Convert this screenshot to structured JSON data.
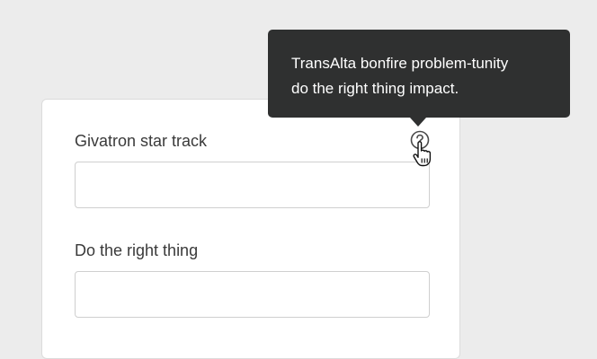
{
  "form": {
    "field1": {
      "label": "Givatron star track",
      "value": "",
      "placeholder": ""
    },
    "field2": {
      "label": "Do the right thing",
      "value": "",
      "placeholder": ""
    }
  },
  "tooltip": {
    "line1": "TransAlta bonfire problem-tunity",
    "line2": "do the right thing impact."
  },
  "icons": {
    "help": "question-circle-icon",
    "cursor": "hand-pointer-icon"
  },
  "colors": {
    "background": "#ececec",
    "card": "#ffffff",
    "tooltip_bg": "#2f3030",
    "tooltip_text": "#ffffff",
    "label_text": "#3a3a3a"
  }
}
